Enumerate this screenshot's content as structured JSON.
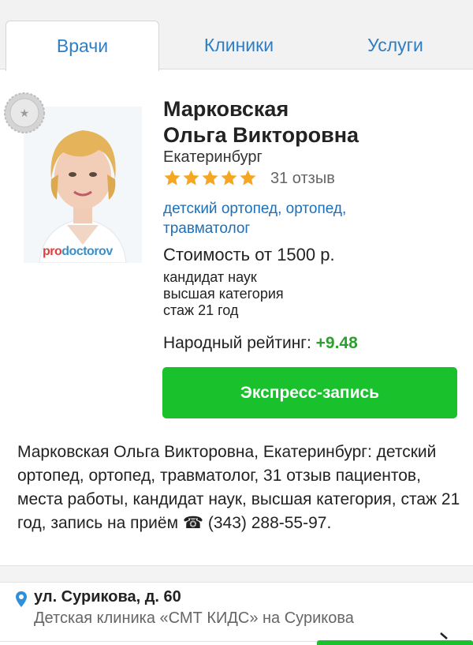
{
  "tabs": [
    {
      "label": "Врачи",
      "active": true
    },
    {
      "label": "Клиники",
      "active": false
    },
    {
      "label": "Услуги",
      "active": false
    }
  ],
  "doctor": {
    "name_line1": "Марковская",
    "name_line2": "Ольга Викторовна",
    "city": "Екатеринбург",
    "stars": 5,
    "reviews": "31 отзыв",
    "specialties_line1": "детский ортопед, ортопед,",
    "specialties_line2": "травматолог",
    "price": "Стоимость от 1500 р.",
    "facts": [
      "кандидат наук",
      "высшая категория",
      "стаж 21 год"
    ],
    "rating_label": "Народный рейтинг: ",
    "rating_value": "+9.48",
    "photo_watermark_pro": "pro",
    "photo_watermark_rest": "doctorov"
  },
  "express_button": "Экспресс-запись",
  "description": "Марковская Ольга Викторовна, Екатеринбург: детский ортопед, ортопед, травматолог, 31 отзыв пациентов, места работы, кандидат наук, высшая категория, стаж 21 год, запись на приём ☎ (343) 288-55-97.",
  "location": {
    "address": "ул. Сурикова, д. 60",
    "clinic": "Детская клиника «СМТ КИДС» на Сурикова"
  },
  "colors": {
    "link": "#2f7ec4",
    "green": "#19c12d",
    "rating_green": "#2ca02c",
    "star": "#f5a623"
  }
}
